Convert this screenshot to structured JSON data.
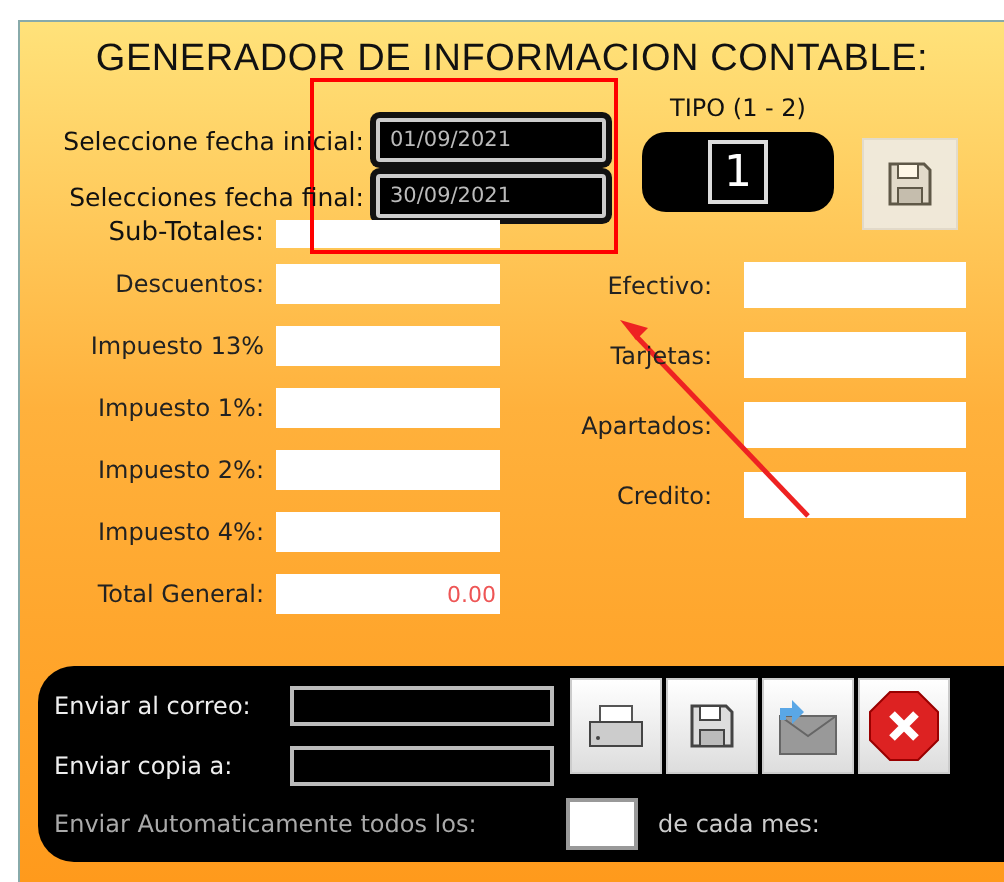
{
  "title": "GENERADOR DE INFORMACION CONTABLE:",
  "dates": [
    {
      "label": "Seleccione fecha  inicial:",
      "value": "01/09/2021"
    },
    {
      "label": "Selecciones fecha final:",
      "value": "30/09/2021"
    }
  ],
  "tipo": {
    "label": "TIPO (1 - 2)",
    "value": "1"
  },
  "subtotales": {
    "label": "Sub-Totales:"
  },
  "left_fields": [
    {
      "label": "Descuentos:"
    },
    {
      "label": "Impuesto 13%"
    },
    {
      "label": "Impuesto 1%:"
    },
    {
      "label": "Impuesto 2%:"
    },
    {
      "label": "Impuesto 4%:"
    },
    {
      "label": "Total General:",
      "value": "0.00"
    }
  ],
  "right_fields": [
    {
      "label": "Efectivo:"
    },
    {
      "label": "Tarjetas:"
    },
    {
      "label": "Apartados:"
    },
    {
      "label": "Credito:"
    }
  ],
  "send": {
    "fields": [
      {
        "label": "Enviar al correo:"
      },
      {
        "label": "Enviar copia a:"
      }
    ],
    "auto_before": "Enviar Automaticamente todos los:",
    "auto_after": "de cada mes:"
  },
  "buttons": [
    {
      "kind": "print"
    },
    {
      "kind": "save"
    },
    {
      "kind": "send"
    },
    {
      "kind": "close"
    }
  ]
}
